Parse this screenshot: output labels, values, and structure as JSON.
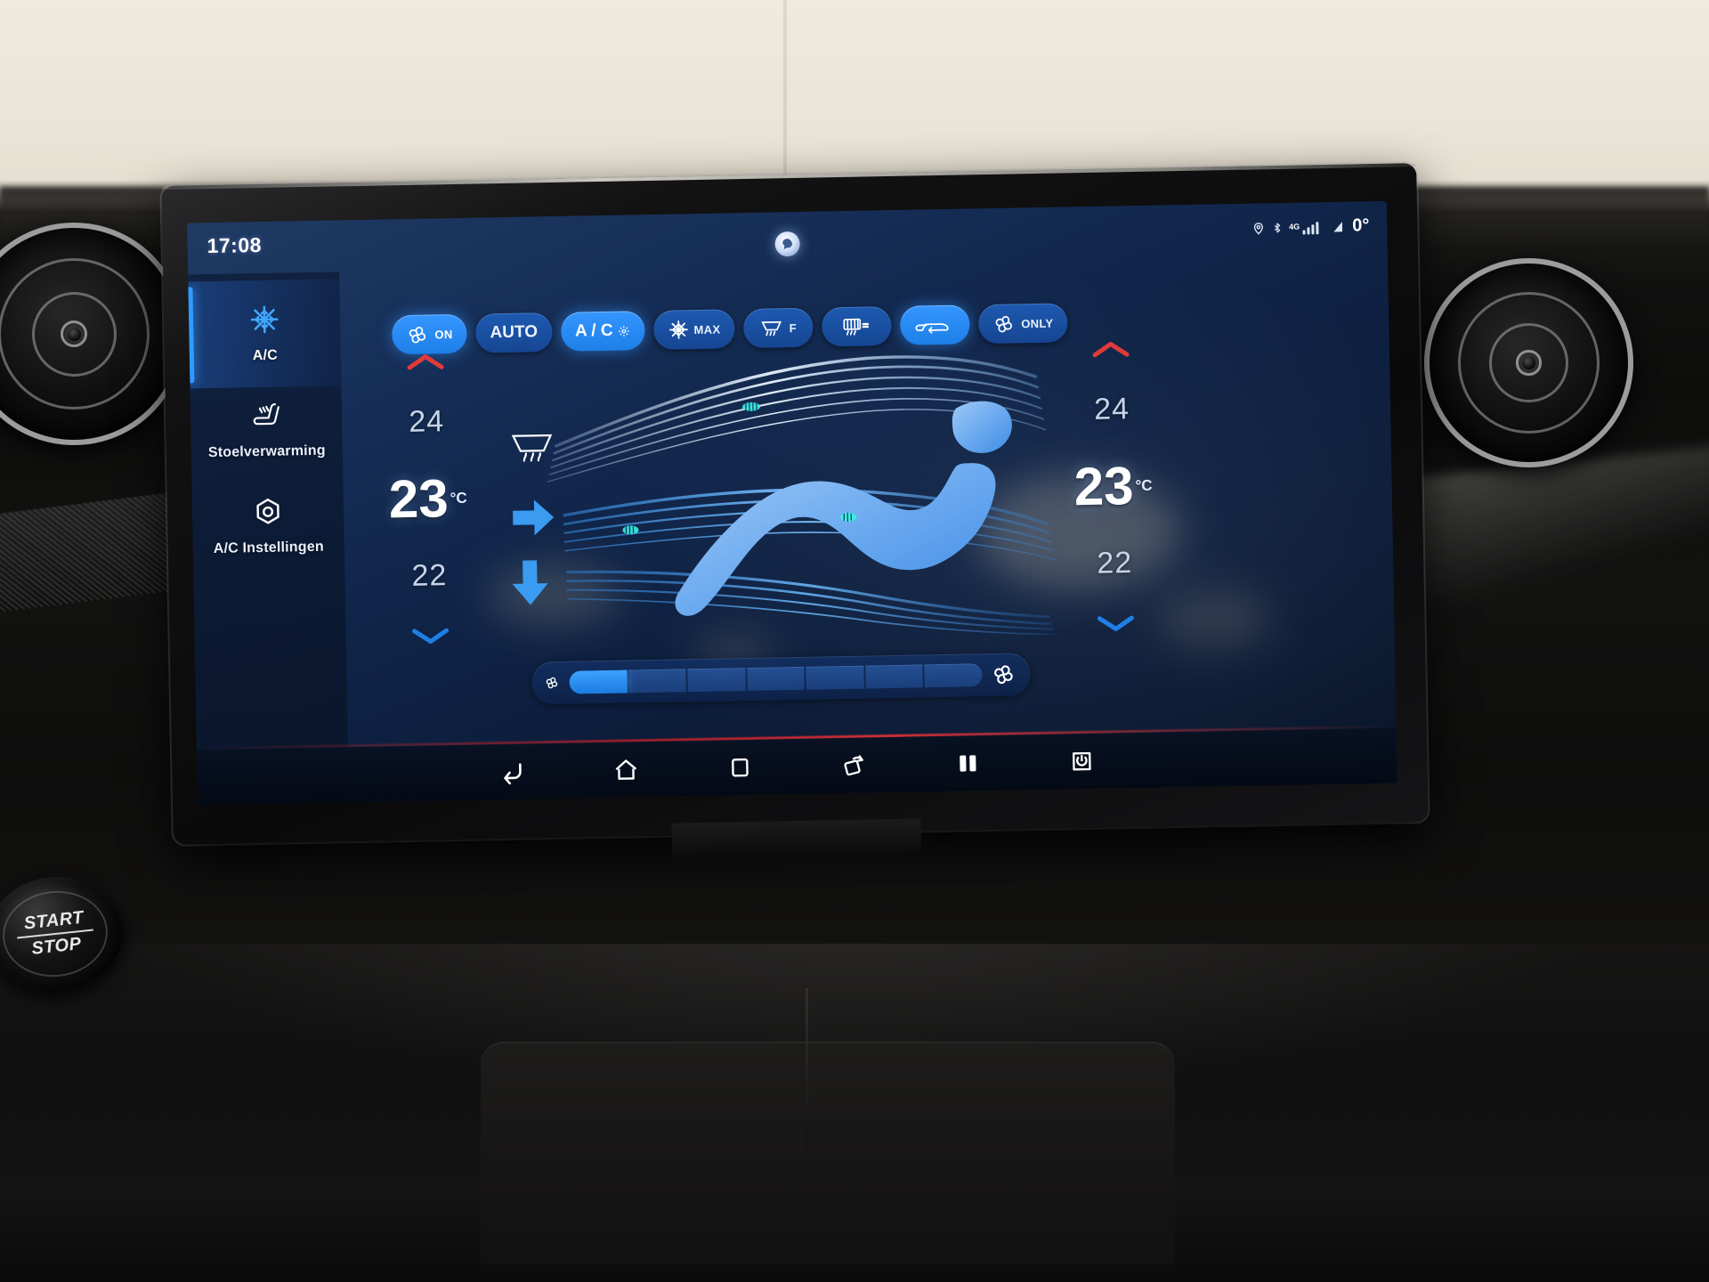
{
  "status_bar": {
    "clock": "17:08",
    "assistant_icon": "assistant-bubble-icon",
    "icons": [
      "location-pin-icon",
      "bluetooth-icon",
      "signal-bars-icon"
    ],
    "network_label": "4G",
    "outside_temp": "0°",
    "outside_temp_icon": "outside-temperature-icon"
  },
  "sidebar": {
    "items": [
      {
        "label": "A/C",
        "icon": "snowflake-icon",
        "active": true
      },
      {
        "label": "Stoelverwarming",
        "icon": "seat-heating-icon",
        "active": false
      },
      {
        "label": "A/C Instellingen",
        "icon": "settings-hex-icon",
        "active": false
      }
    ]
  },
  "toolbar": {
    "buttons": [
      {
        "label": "ON",
        "icon": "fan-icon",
        "active": true
      },
      {
        "label": "AUTO",
        "icon": "",
        "active": false
      },
      {
        "label": "A / C",
        "icon": "ac-flower-icon",
        "active": true
      },
      {
        "label": "MAX",
        "icon": "snowflake-icon",
        "active": false
      },
      {
        "label": "F",
        "icon": "front-defrost-icon",
        "active": false
      },
      {
        "label": "",
        "icon": "rear-defrost-icon",
        "active": false
      },
      {
        "label": "",
        "icon": "recirculation-icon",
        "active": true
      },
      {
        "label": "ONLY",
        "icon": "fan-icon",
        "active": false
      }
    ]
  },
  "climate": {
    "left": {
      "up_icon": "chevron-up-icon",
      "step_up": "24",
      "value": "23",
      "unit": "°C",
      "step_down": "22",
      "down_icon": "chevron-down-icon"
    },
    "right": {
      "up_icon": "chevron-up-icon",
      "step_up": "24",
      "value": "23",
      "unit": "°C",
      "step_down": "22",
      "down_icon": "chevron-down-icon"
    }
  },
  "airflow_graphic": {
    "seat_icon": "seat-silhouette-icon",
    "defrost_vent_icon": "windshield-defrost-icon",
    "face_vent_icon": "face-vent-arrow-icon",
    "floor_vent_icon": "floor-vent-arrow-icon"
  },
  "fan_slider": {
    "min_icon": "fan-small-icon",
    "max_icon": "fan-large-icon",
    "segments": 7,
    "level": 1
  },
  "nav_bar": {
    "buttons": [
      {
        "icon": "back-icon"
      },
      {
        "icon": "home-icon"
      },
      {
        "icon": "recents-square-icon"
      },
      {
        "icon": "rotate-screen-icon"
      },
      {
        "icon": "split-screen-icon"
      },
      {
        "icon": "screen-off-power-icon"
      }
    ]
  },
  "hardware": {
    "start_stop_top": "START",
    "start_stop_bottom": "STOP",
    "left_vent": "dashboard-air-vent",
    "right_vent": "dashboard-air-vent"
  },
  "colors": {
    "accent_blue": "#2f9bff",
    "pill_active": "#3596ff",
    "pill_idle": "#1e5eb8",
    "screen_bg": "#0f2346",
    "hot_red": "#e03a3a",
    "cold_blue": "#1f7fe6"
  }
}
